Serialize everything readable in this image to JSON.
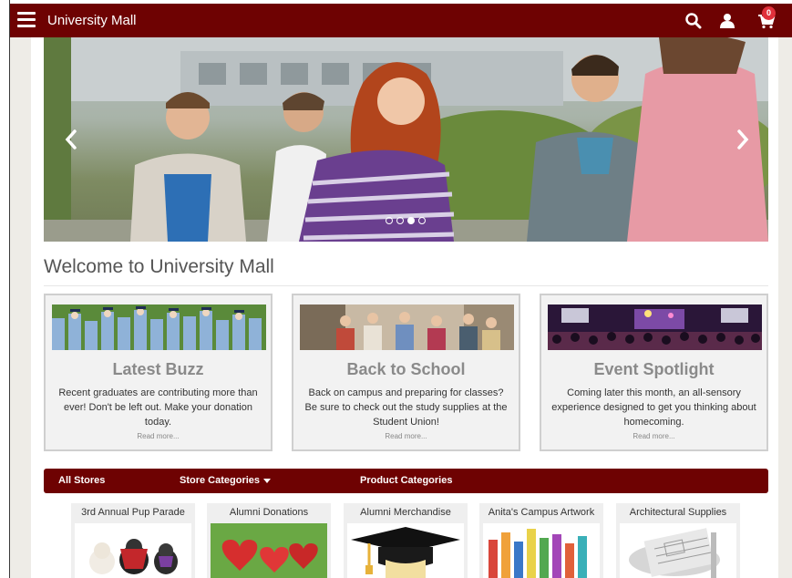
{
  "header": {
    "brand": "University Mall",
    "cart_count": "0"
  },
  "hero": {
    "slide_count": 4,
    "active_slide": 3
  },
  "welcome": {
    "title": "Welcome to University Mall"
  },
  "cards": [
    {
      "title": "Latest Buzz",
      "body": "Recent graduates are contributing more than ever! Don't be left out. Make your donation today.",
      "more": "Read more..."
    },
    {
      "title": "Back to School",
      "body": "Back on campus and preparing for classes? Be sure to check out the study supplies at the Student Union!",
      "more": "Read more..."
    },
    {
      "title": "Event Spotlight",
      "body": "Coming later this month, an all-sensory experience designed to get you thinking about homecoming.",
      "more": "Read more..."
    }
  ],
  "stores_nav": {
    "all_stores": "All Stores",
    "store_categories": "Store Categories",
    "product_categories": "Product Categories"
  },
  "stores": [
    {
      "name": "3rd Annual Pup Parade"
    },
    {
      "name": "Alumni Donations"
    },
    {
      "name": "Alumni Merchandise"
    },
    {
      "name": "Anita's Campus Artwork"
    },
    {
      "name": "Architectural Supplies"
    }
  ],
  "colors": {
    "brand": "#6e0202",
    "badge": "#e0303a"
  }
}
